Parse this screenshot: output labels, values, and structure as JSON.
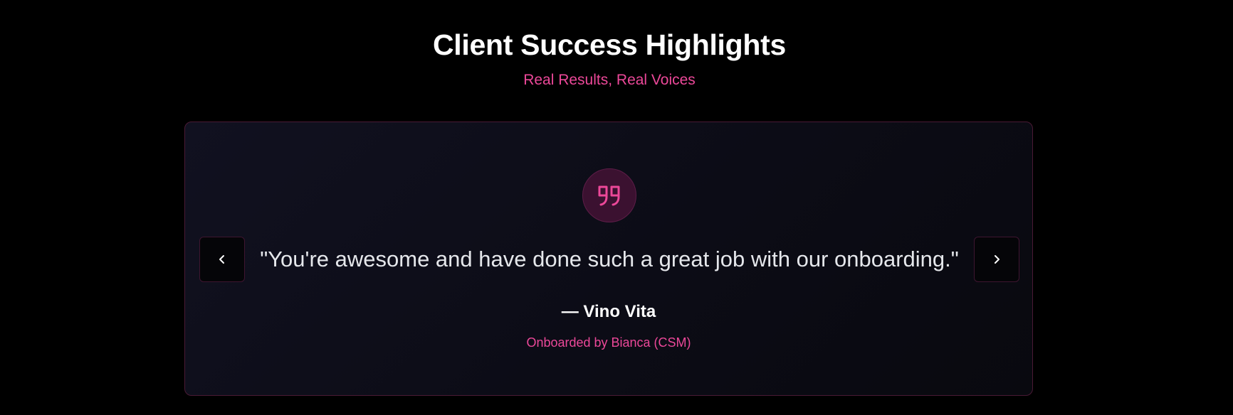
{
  "header": {
    "title": "Client Success Highlights",
    "subtitle": "Real Results, Real Voices"
  },
  "testimonial": {
    "quote": "\"You're awesome and have done such a great job with our onboarding.\"",
    "author": "— Vino Vita",
    "meta": "Onboarded by Bianca (CSM)"
  },
  "icons": {
    "quote": "quote-icon",
    "prev": "chevron-left-icon",
    "next": "chevron-right-icon"
  },
  "colors": {
    "background": "#000000",
    "accent": "#ec4899",
    "card_border": "#4a1a35",
    "text_primary": "#ffffff",
    "text_quote": "#e5e7eb"
  }
}
